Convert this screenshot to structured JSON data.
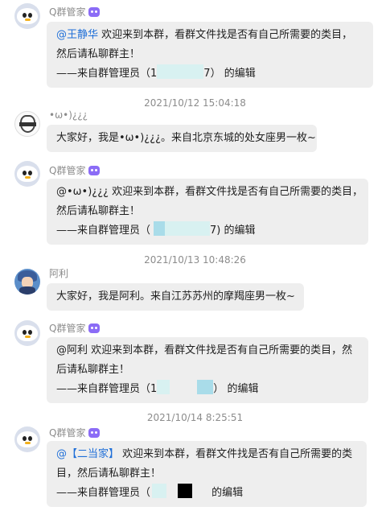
{
  "messages": [
    {
      "sender": "Q群管家",
      "mention": "@王静华",
      "line1_rest": " 欢迎来到本群，看群文件找是否有自己所需要的类目，",
      "line2": "然后请私聊群主！",
      "admin_prefix": "——来自群管理员（",
      "admin_visible_mid": "1",
      "admin_visible_tail": "7）",
      "admin_suffix": "的编辑"
    },
    {
      "timestamp": "2021/10/12 15:04:18",
      "sender": "•ω•)¿¿¿",
      "text": "大家好，我是•ω•)¿¿¿。来自北京东城的处女座男一枚~"
    },
    {
      "sender": "Q群管家",
      "mention": "@•ω•)¿¿¿",
      "line1_rest": " 欢迎来到本群，看群文件找是否有自己所需要的类目，",
      "line2": "然后请私聊群主！",
      "admin_prefix": "——来自群管理员（",
      "admin_visible_tail": "7)",
      "admin_suffix": "的编辑"
    },
    {
      "timestamp": "2021/10/13 10:48:26",
      "sender": "阿利",
      "text": "大家好，我是阿利。来自江苏苏州的摩羯座男一枚~"
    },
    {
      "sender": "Q群管家",
      "mention": "@阿利",
      "line1_rest": " 欢迎来到本群，看群文件找是否有自己所需要的类目，然",
      "line2": "后请私聊群主！",
      "admin_prefix": "——来自群管理员（",
      "admin_visible_mid": "1",
      "admin_visible_tail": "）",
      "admin_suffix": "的编辑"
    },
    {
      "timestamp": "2021/10/14 8:25:51",
      "sender": "Q群管家",
      "mention": "@【二当家】",
      "line1_rest": " 欢迎来到本群，看群文件找是否有自己所需要的类",
      "line2": "目，然后请私聊群主！",
      "admin_prefix": "——来自群管理员（",
      "admin_suffix": "的编辑"
    }
  ],
  "icons": {
    "qq_bot_avatar": "penguin-avatar-icon",
    "bot_badge": "robot-badge-icon",
    "user1_avatar": "shield-logo-avatar-icon",
    "user2_avatar": "anime-character-avatar-icon"
  },
  "colors": {
    "bubble_bg": "#eeeeee",
    "mention": "#1f6fd8",
    "meta_text": "#8c8c8c",
    "bot_badge": "#8b6cf6"
  }
}
